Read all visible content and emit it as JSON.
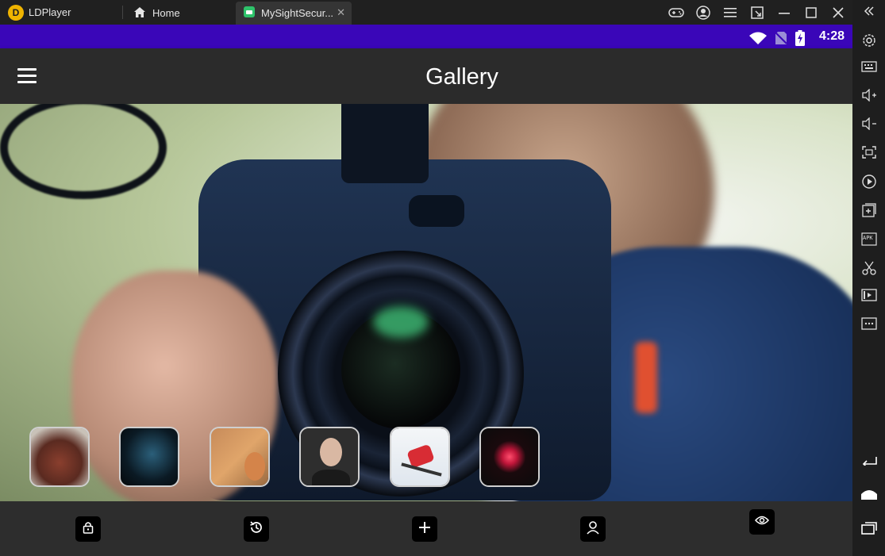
{
  "emulator": {
    "app_name": "LDPlayer",
    "tabs": [
      {
        "label": "Home",
        "icon": "home-icon"
      },
      {
        "label": "MySightSecur...",
        "icon": "android-icon",
        "close": "✕"
      }
    ],
    "window_controls": [
      "gamepad-icon",
      "account-icon",
      "menu-icon",
      "resize-icon",
      "minimize-icon",
      "maximize-icon",
      "close-icon"
    ]
  },
  "sidebar": {
    "items": [
      "settings-icon",
      "keyboard-icon",
      "volume-up-icon",
      "volume-down-icon",
      "fullscreen-icon",
      "sync-icon",
      "add-window-icon",
      "apk-icon",
      "scissors-icon",
      "video-icon",
      "more-icon",
      "back-icon",
      "home-icon",
      "recents-icon"
    ],
    "apk_label": "APK"
  },
  "status_bar": {
    "time": "4:28",
    "color": "#3a06b8",
    "icons": [
      "wifi-icon",
      "no-sim-icon",
      "battery-charging-icon"
    ]
  },
  "app_bar": {
    "title": "Gallery"
  },
  "gallery": {
    "thumbnails": [
      {
        "subject": "food",
        "icon": "thumb-food"
      },
      {
        "subject": "cyclist",
        "icon": "thumb-cyclist"
      },
      {
        "subject": "cat",
        "icon": "thumb-cat"
      },
      {
        "subject": "portrait",
        "icon": "thumb-portrait"
      },
      {
        "subject": "skier",
        "icon": "thumb-skier"
      },
      {
        "subject": "flower",
        "icon": "thumb-flower"
      }
    ]
  },
  "bottom_nav": {
    "items": [
      "lock-icon",
      "history-icon",
      "add-icon",
      "profile-icon",
      "eye-icon"
    ]
  }
}
